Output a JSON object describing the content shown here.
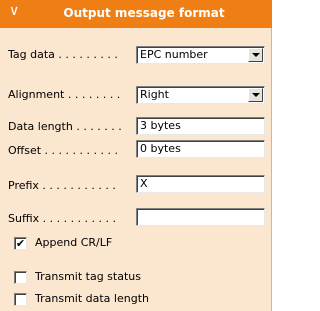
{
  "header": {
    "title": "Output message format",
    "collapse_icon": "chevron-down-icon"
  },
  "fields": {
    "tag_data": {
      "label": "Tag data . . . . . . . . .",
      "value": "EPC number"
    },
    "alignment": {
      "label": "Alignment . . . . . . . .",
      "value": "Right"
    },
    "data_length": {
      "label": "Data length . . . . . . .",
      "value": "3 bytes"
    },
    "offset": {
      "label": "Offset . . . . . . . . . . .",
      "value": "0 bytes"
    },
    "prefix": {
      "label": "Prefix . . . . . . . . . . .",
      "value": "X"
    },
    "suffix": {
      "label": "Suffix . . . . . . . . . . .",
      "value": ""
    }
  },
  "checkboxes": {
    "append_crlf": {
      "label": "Append CR/LF",
      "checked": true,
      "mark": "✔"
    },
    "transmit_tag_status": {
      "label": "Transmit tag status",
      "checked": false,
      "mark": ""
    },
    "transmit_data_length": {
      "label": "Transmit data length",
      "checked": false,
      "mark": ""
    }
  },
  "colors": {
    "header": "#ef7f15",
    "panel": "#fbe6cf"
  }
}
